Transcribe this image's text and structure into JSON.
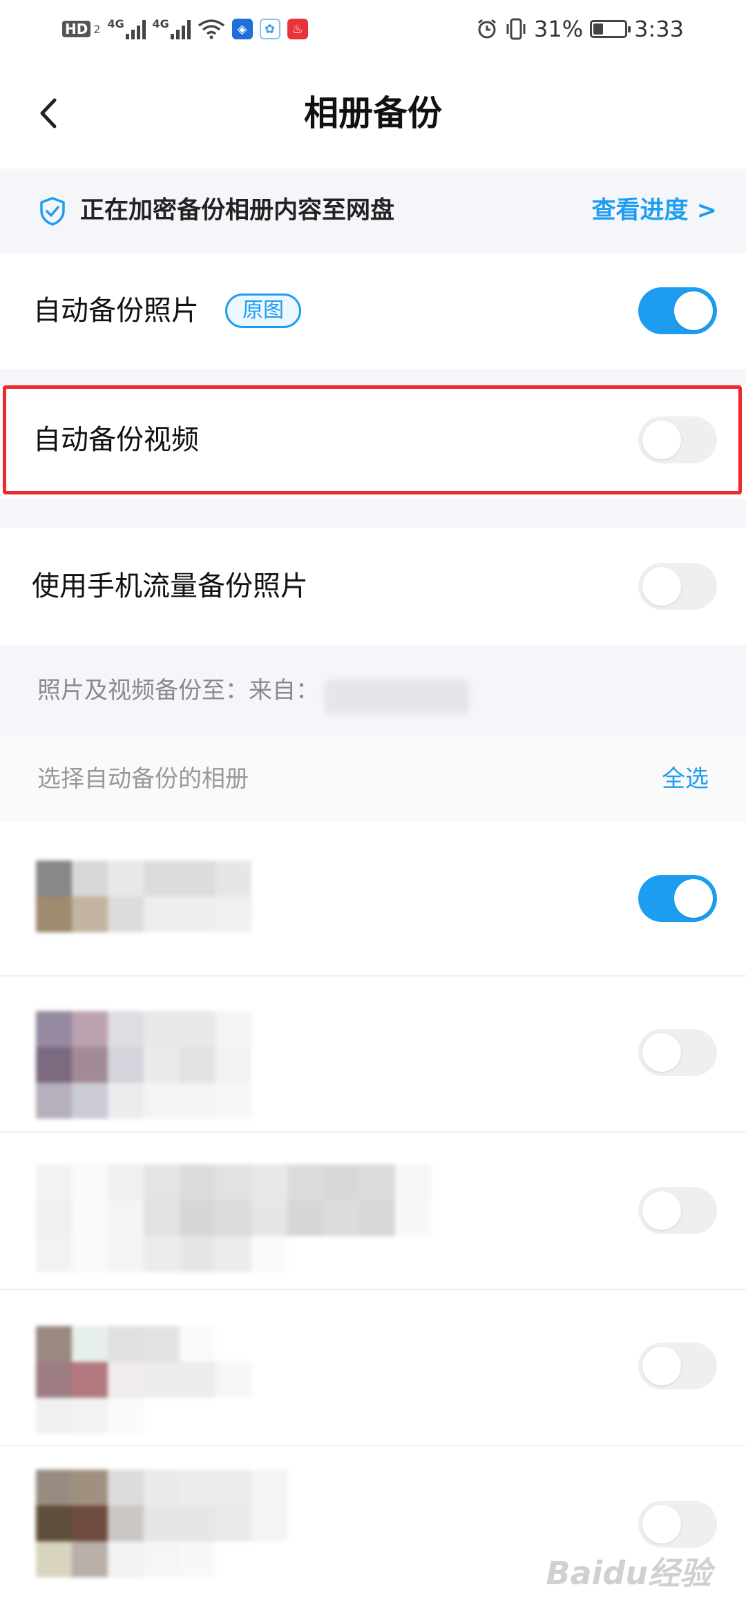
{
  "status_bar": {
    "hd_label": "HD",
    "hd_sub": "2",
    "signal_label_1": "4G",
    "signal_label_2": "4G",
    "battery_percent": "31%",
    "battery_level": 0.31,
    "time": "3:33"
  },
  "nav": {
    "title": "相册备份"
  },
  "banner": {
    "text": "正在加密备份相册内容至网盘",
    "link": "查看进度 >"
  },
  "settings": {
    "auto_photo_label": "自动备份照片",
    "auto_photo_tag": "原图",
    "auto_photo_on": true,
    "auto_video_label": "自动备份视频",
    "auto_video_on": false,
    "mobile_data_label": "使用手机流量备份照片",
    "mobile_data_on": false
  },
  "backup_target": {
    "label": "照片及视频备份至：来自："
  },
  "albums_section": {
    "label": "选择自动备份的相册",
    "select_all": "全选",
    "albums": [
      {
        "on": true
      },
      {
        "on": false
      },
      {
        "on": false
      },
      {
        "on": false
      },
      {
        "on": false
      }
    ]
  },
  "watermark": "Baidu经验",
  "colors": {
    "accent": "#1c9df0",
    "highlight": "#f0282a",
    "section_bg": "#f5f6fa"
  }
}
